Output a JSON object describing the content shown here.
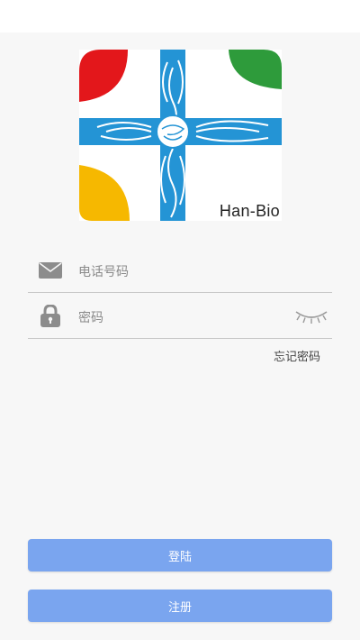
{
  "brand": {
    "name": "Han-Bio",
    "colors": {
      "red": "#e3171b",
      "green": "#2e9b3b",
      "yellow": "#f6b800",
      "blue": "#2494d5"
    }
  },
  "login_form": {
    "phone": {
      "placeholder": "电话号码",
      "icon": "envelope-icon"
    },
    "password": {
      "placeholder": "密码",
      "icon": "lock-icon",
      "toggle_icon": "eye-closed-icon"
    },
    "forgot_password": "忘记密码",
    "login_button": "登陆",
    "register_button": "注册"
  },
  "theme": {
    "button_color": "#7aa5ef"
  }
}
